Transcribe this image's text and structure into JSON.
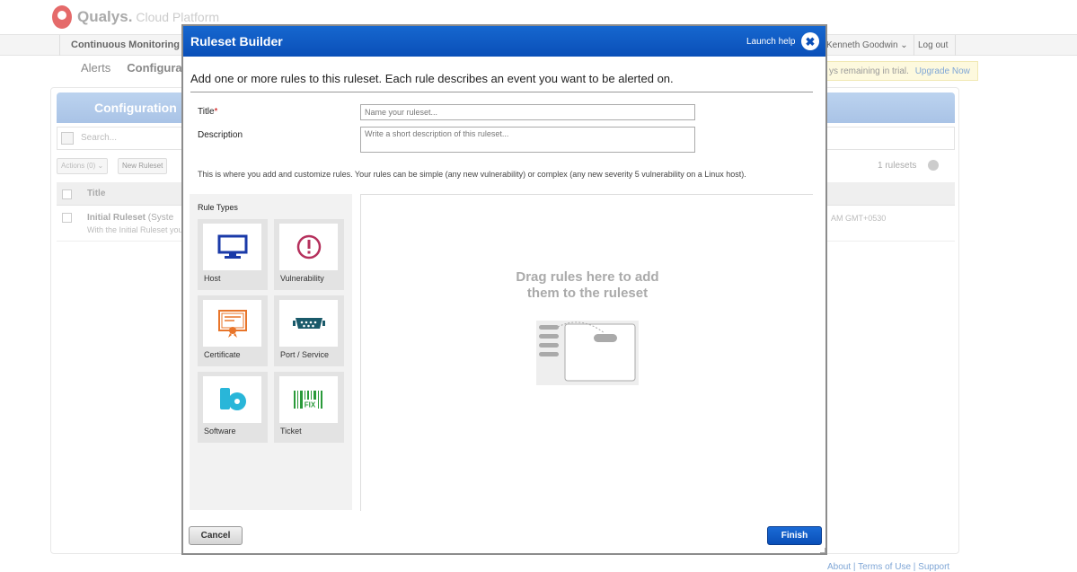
{
  "app": {
    "logo_text": "Qualys.",
    "logo_sub": "Cloud Platform",
    "module": "Continuous Monitoring",
    "user": "Kenneth Goodwin",
    "logout": "Log out",
    "trial_text": "ys remaining in trial.",
    "upgrade": "Upgrade Now",
    "subnav": [
      "Alerts",
      "Configurat"
    ],
    "footer": "About | Terms of Use | Support"
  },
  "config_panel": {
    "title": "Configuration",
    "search_placeholder": "Search...",
    "actions_label": "Actions (0)",
    "new_ruleset_label": "New Ruleset",
    "ruleset_count": "1 rulesets",
    "col_title": "Title",
    "row_title": "Initial Ruleset",
    "row_title_suffix": "(Syste",
    "row_desc": "With the Initial Ruleset you",
    "row_time": "AM GMT+0530"
  },
  "modal": {
    "title": "Ruleset Builder",
    "launch_help": "Launch help",
    "intro": "Add one or more rules to this ruleset. Each rule describes an event you want to be alerted on.",
    "title_label": "Title",
    "title_required_mark": "*",
    "title_placeholder": "Name your ruleset...",
    "desc_label": "Description",
    "desc_placeholder": "Write a short description of this ruleset...",
    "hint": "This is where you add and customize rules. Your rules can be simple (any new vulnerability) or complex (any new severity 5 vulnerability on a Linux host).",
    "rule_types_label": "Rule Types",
    "rule_types": [
      {
        "label": "Host",
        "icon": "monitor-icon",
        "color": "#1a3aa8"
      },
      {
        "label": "Vulnerability",
        "icon": "exclamation-circle-icon",
        "color": "#b5305c"
      },
      {
        "label": "Certificate",
        "icon": "certificate-icon",
        "color": "#e8752a"
      },
      {
        "label": "Port / Service",
        "icon": "port-icon",
        "color": "#1a5a6a"
      },
      {
        "label": "Software",
        "icon": "software-disc-icon",
        "color": "#29b6d9"
      },
      {
        "label": "Ticket",
        "icon": "barcode-ticket-icon",
        "color": "#2a9a3a"
      }
    ],
    "fix_text": "FIX",
    "drop_text_line1": "Drag rules here to add",
    "drop_text_line2": "them to the ruleset",
    "cancel_label": "Cancel",
    "finish_label": "Finish"
  },
  "colors": {
    "modal_header": "#0a4fb8",
    "finish_button": "#0a4fb8",
    "panel_header": "#a9c3e6"
  }
}
